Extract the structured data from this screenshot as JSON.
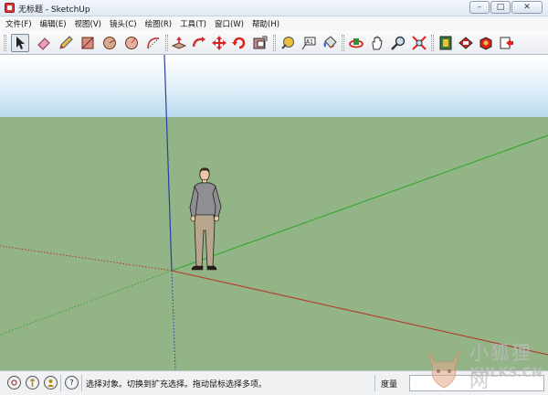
{
  "window": {
    "title": "无标题 - SketchUp",
    "controls": {
      "minimize": "–",
      "maximize": "□",
      "close": "✕"
    }
  },
  "menu": [
    "文件(F)",
    "编辑(E)",
    "视图(V)",
    "镜头(C)",
    "绘图(R)",
    "工具(T)",
    "窗口(W)",
    "帮助(H)"
  ],
  "toolbar": {
    "tools": [
      {
        "name": "select",
        "icon": "cursor-arrow-icon",
        "active": true
      },
      {
        "name": "eraser",
        "icon": "eraser-icon"
      },
      {
        "name": "pencil",
        "icon": "pencil-icon"
      },
      {
        "name": "rectangle",
        "icon": "rectangle-icon"
      },
      {
        "name": "circle",
        "icon": "circle-icon"
      },
      {
        "name": "polygon",
        "icon": "polygon-icon"
      },
      {
        "name": "arc",
        "icon": "arc-icon"
      },
      {
        "name": "push-pull",
        "icon": "push-pull-icon"
      },
      {
        "name": "follow-me",
        "icon": "follow-me-icon"
      },
      {
        "name": "move",
        "icon": "move-icon"
      },
      {
        "name": "rotate",
        "icon": "rotate-icon"
      },
      {
        "name": "offset",
        "icon": "offset-icon"
      },
      {
        "name": "tape-measure",
        "icon": "tape-measure-icon"
      },
      {
        "name": "text",
        "icon": "text-icon"
      },
      {
        "name": "paint-bucket",
        "icon": "paint-bucket-icon"
      },
      {
        "name": "orbit",
        "icon": "orbit-icon"
      },
      {
        "name": "pan",
        "icon": "pan-hand-icon"
      },
      {
        "name": "zoom",
        "icon": "zoom-icon"
      },
      {
        "name": "zoom-extents",
        "icon": "zoom-extents-icon"
      },
      {
        "name": "warehouse",
        "icon": "warehouse-icon"
      },
      {
        "name": "share-model",
        "icon": "share-model-icon"
      },
      {
        "name": "components",
        "icon": "components-icon"
      },
      {
        "name": "send-to-layout",
        "icon": "send-to-layout-icon"
      }
    ],
    "text_tool_glyph": "A1"
  },
  "colors": {
    "ground": "#93b487",
    "sky_top": "#ffffff",
    "sky_bottom": "#b9d9ee",
    "axis_red": "#b23a2a",
    "axis_green": "#2fa82f",
    "axis_blue": "#2b3fa6"
  },
  "statusbar": {
    "icons": [
      "geo-location-icon",
      "credits-icon",
      "user-icon",
      "help-icon"
    ],
    "help_glyph": "?",
    "message": "选择对象。切换到扩充选择。拖动鼠标选择多项。",
    "measure_label": "度量",
    "measure_value": ""
  },
  "watermark": {
    "text": "小狐狸网",
    "subtext": "XHLKS.CN"
  }
}
